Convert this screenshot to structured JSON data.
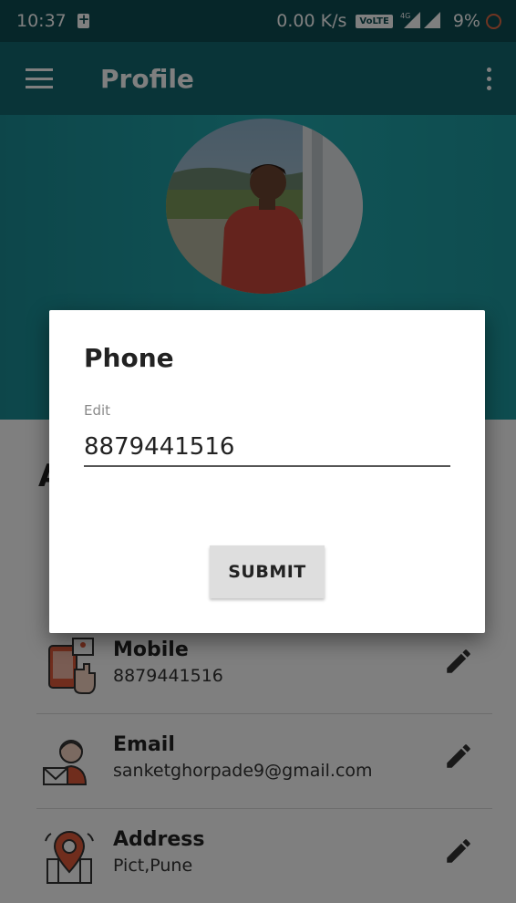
{
  "status_bar": {
    "time": "10:37",
    "speed": "0.00 K/s",
    "volte": "VoLTE",
    "network": "4G",
    "battery": "9%"
  },
  "app_bar": {
    "title": "Profile",
    "menu_icon": "hamburger-menu-icon",
    "more_icon": "more-vert-icon",
    "color": "#126870"
  },
  "header": {
    "avatar": "profile-photo"
  },
  "content": {
    "section_letter": "A",
    "rows": [
      {
        "title": "Mobile",
        "value": "8879441516",
        "icon": "mobile-phone-icon"
      },
      {
        "title": "Email",
        "value": "sanketghorpade9@gmail.com",
        "icon": "email-person-icon"
      },
      {
        "title": "Address",
        "value": "Pict,Pune",
        "icon": "location-map-icon"
      }
    ]
  },
  "dialog": {
    "title": "Phone",
    "field_label": "Edit",
    "field_value": "8879441516",
    "submit_label": "SUBMIT"
  }
}
